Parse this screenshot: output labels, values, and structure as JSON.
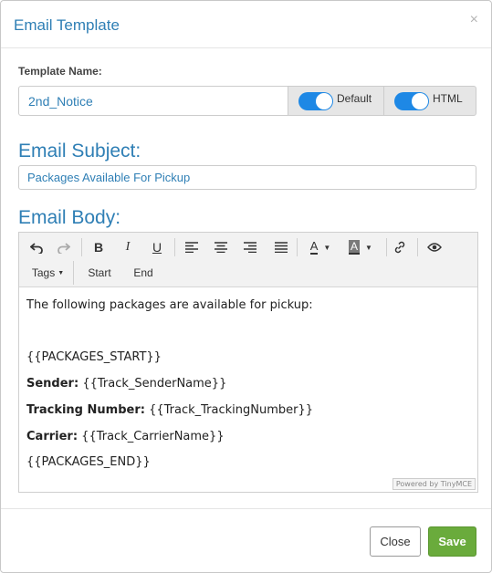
{
  "dialog": {
    "title": "Email Template",
    "close_symbol": "×"
  },
  "template_name": {
    "label": "Template Name:",
    "value": "2nd_Notice",
    "toggles": [
      {
        "label": "Default",
        "on": true
      },
      {
        "label": "HTML",
        "on": true
      }
    ]
  },
  "subject": {
    "heading": "Email Subject:",
    "value": "Packages Available For Pickup"
  },
  "body": {
    "heading": "Email Body:",
    "toolbar": {
      "icons": [
        "undo-icon",
        "redo-icon",
        "bold-icon",
        "italic-icon",
        "underline-icon",
        "align-left-icon",
        "align-center-icon",
        "align-right-icon",
        "justify-icon",
        "text-color-icon",
        "background-color-icon",
        "link-icon",
        "preview-icon"
      ],
      "tags_label": "Tags",
      "start_label": "Start",
      "end_label": "End",
      "font_letter": "A"
    },
    "content": {
      "intro": "The following packages are available for pickup:",
      "packages_start": "{{PACKAGES_START}}",
      "sender_label": "Sender:",
      "sender_value": "{{Track_SenderName}}",
      "tracking_label": "Tracking Number:",
      "tracking_value": "{{Track_TrackingNumber}}",
      "carrier_label": "Carrier:",
      "carrier_value": "{{Track_CarrierName}}",
      "packages_end": "{{PACKAGES_END}}"
    },
    "powered_by": "Powered by TinyMCE"
  },
  "footer": {
    "close_label": "Close",
    "save_label": "Save"
  },
  "colors": {
    "accent": "#2f7fb5",
    "toggle": "#1e88e5",
    "save": "#6aab3c"
  }
}
